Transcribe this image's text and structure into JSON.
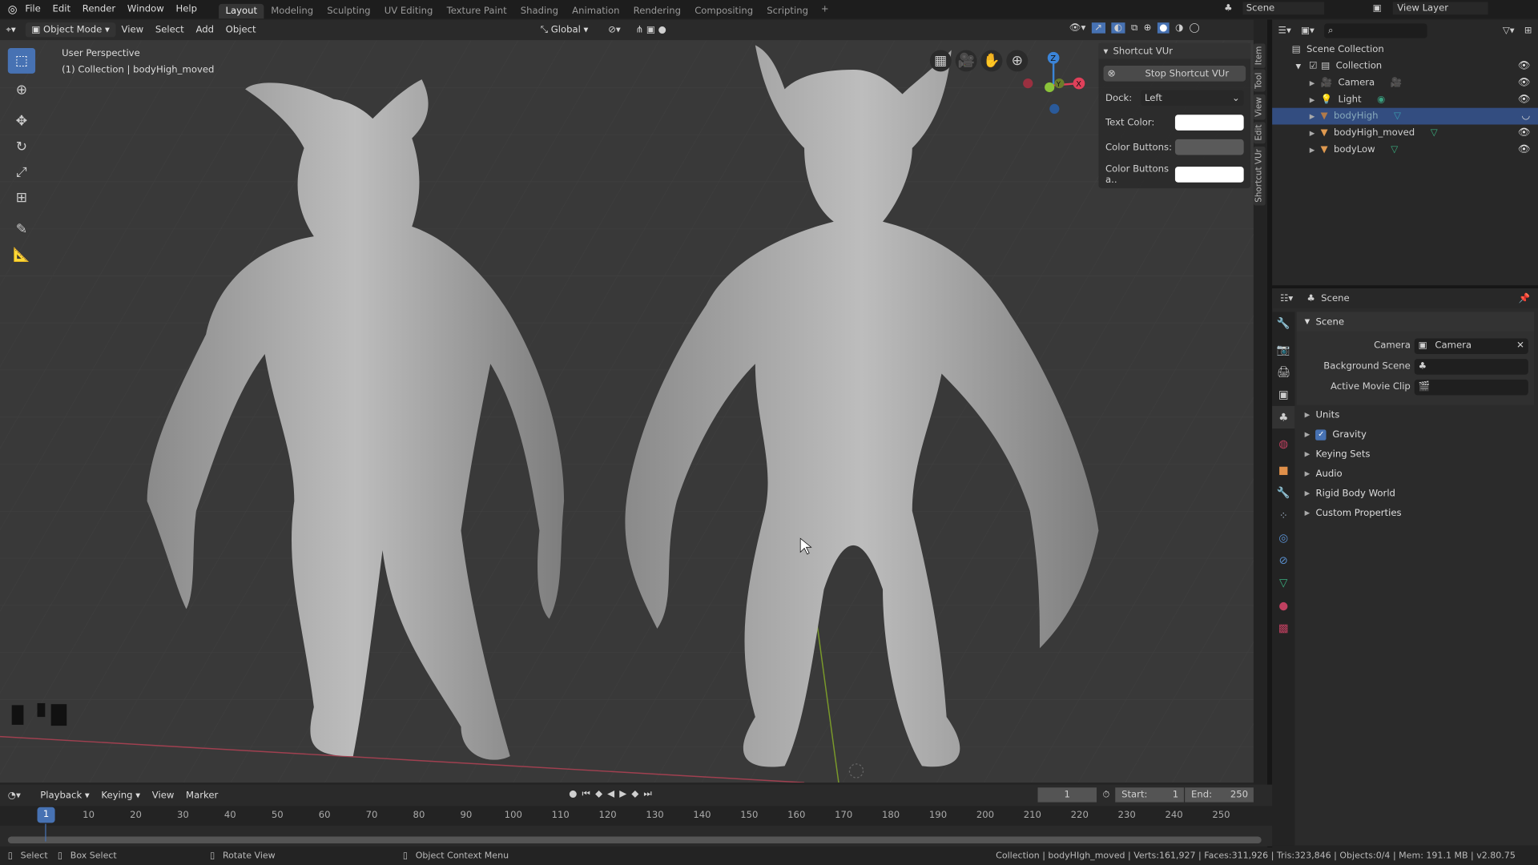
{
  "topbar": {
    "menu": [
      "File",
      "Edit",
      "Render",
      "Window",
      "Help"
    ],
    "workspaces": [
      "Layout",
      "Modeling",
      "Sculpting",
      "UV Editing",
      "Texture Paint",
      "Shading",
      "Animation",
      "Rendering",
      "Compositing",
      "Scripting"
    ],
    "active_workspace": "Layout",
    "add_tab": "+",
    "scene": "Scene",
    "view_layer": "View Layer"
  },
  "viewport_header": {
    "mode": "Object Mode",
    "menus": [
      "View",
      "Select",
      "Add",
      "Object"
    ],
    "orientation": "Global"
  },
  "viewport": {
    "view_name": "User Perspective",
    "collection_info": "(1) Collection | bodyHigh_moved"
  },
  "gizmo": {
    "z": "Z",
    "y": "Y",
    "x": "X"
  },
  "shortcut_panel": {
    "title": "Shortcut VUr",
    "stop_button": "Stop Shortcut VUr",
    "dock_label": "Dock:",
    "dock_value": "Left",
    "text_color_label": "Text Color:",
    "color_buttons_label": "Color Buttons:",
    "color_buttons_a_label": "Color Buttons a..",
    "text_color": "#ffffff",
    "color_buttons": "#5a5a5a",
    "color_buttons_a": "#ffffff"
  },
  "sidebar_tabs": [
    "Item",
    "Tool",
    "View",
    "Edit",
    "Shortcut VUr"
  ],
  "outliner": {
    "root": "Scene Collection",
    "collection": "Collection",
    "items": [
      {
        "name": "Camera",
        "selected": false
      },
      {
        "name": "Light",
        "selected": false
      },
      {
        "name": "bodyHigh",
        "selected": true
      },
      {
        "name": "bodyHigh_moved",
        "selected": false
      },
      {
        "name": "bodyLow",
        "selected": false
      }
    ]
  },
  "properties": {
    "header": "Scene",
    "section": "Scene",
    "fields": [
      {
        "label": "Camera",
        "value": "Camera"
      },
      {
        "label": "Background Scene",
        "value": ""
      },
      {
        "label": "Active Movie Clip",
        "value": ""
      }
    ],
    "subsections": [
      "Units",
      "Gravity",
      "Keying Sets",
      "Audio",
      "Rigid Body World",
      "Custom Properties"
    ],
    "gravity_checked": true
  },
  "timeline": {
    "menus": [
      "Playback",
      "Keying",
      "View",
      "Marker"
    ],
    "current_frame": "1",
    "start_label": "Start:",
    "start": "1",
    "end_label": "End:",
    "end": "250",
    "ticks": [
      "10",
      "20",
      "30",
      "40",
      "50",
      "60",
      "70",
      "80",
      "90",
      "100",
      "110",
      "120",
      "130",
      "140",
      "150",
      "160",
      "170",
      "180",
      "190",
      "200",
      "210",
      "220",
      "230",
      "240",
      "250"
    ]
  },
  "statusbar": {
    "select": "Select",
    "box_select": "Box Select",
    "rotate_view": "Rotate View",
    "context_menu": "Object Context Menu",
    "stats": "Collection | bodyHIgh_moved | Verts:161,927 | Faces:311,926 | Tris:323,846 | Objects:0/4 | Mem: 191.1 MB | v2.80.75"
  },
  "colors": {
    "accent": "#4772b3",
    "selection": "#334d80",
    "x_axis": "#e0405a",
    "y_axis": "#8bc33a",
    "z_axis": "#3b84d8"
  }
}
